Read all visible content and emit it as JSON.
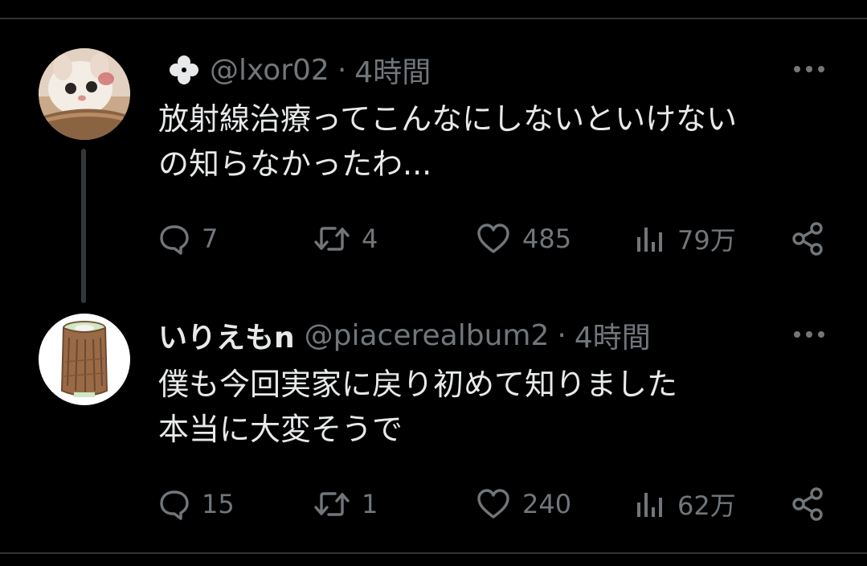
{
  "tweets": [
    {
      "display_name": "",
      "handle": "@lxor02",
      "separator": "·",
      "time": "4時間",
      "avatar": "cat-photo-avatar",
      "name_icon": "clover-icon",
      "text_lines": [
        "放射線治療ってこんなにしないといけない",
        "の知らなかったわ..."
      ],
      "replies": "7",
      "retweets": "4",
      "likes": "485",
      "views": "79万"
    },
    {
      "display_name": "いりえもn",
      "handle": "@piacerealbum2",
      "separator": "·",
      "time": "4時間",
      "avatar": "log-roll-avatar",
      "text_lines": [
        "僕も今回実家に戻り初めて知りました",
        "本当に大変そうで"
      ],
      "replies": "15",
      "retweets": "1",
      "likes": "240",
      "views": "62万"
    }
  ],
  "colors": {
    "background": "#000000",
    "primary_text": "#e7e9ea",
    "secondary_text": "#71767b",
    "divider": "#2f3336"
  }
}
